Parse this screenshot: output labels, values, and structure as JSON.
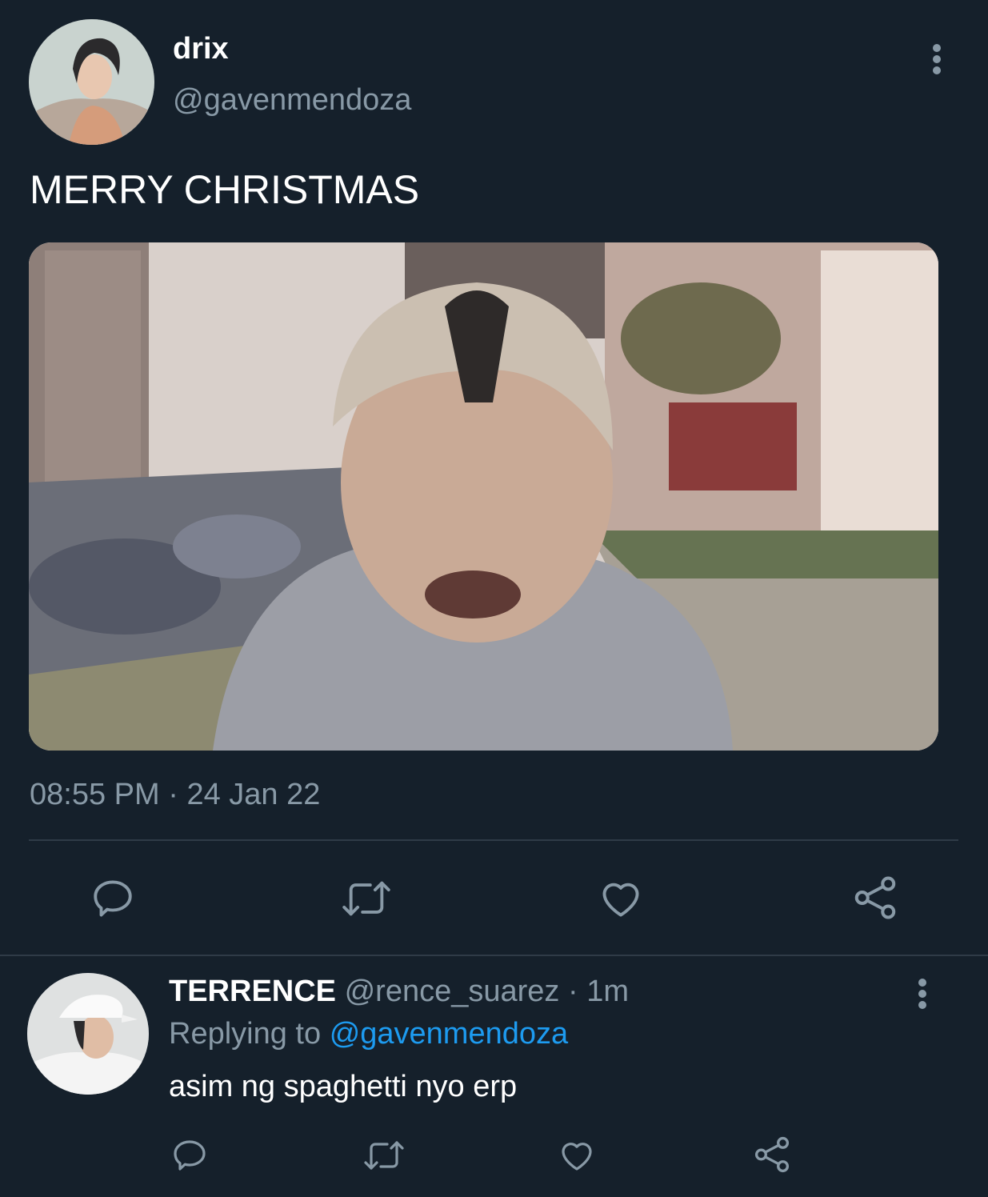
{
  "tweet": {
    "display_name": "drix",
    "handle": "@gavenmendoza",
    "text": "MERRY CHRISTMAS",
    "time": "08:55 PM",
    "separator": "·",
    "date": "24 Jan 22",
    "more_icon": "more-vertical-icon"
  },
  "actions": [
    {
      "name": "reply",
      "icon": "comment-icon"
    },
    {
      "name": "retweet",
      "icon": "retweet-icon"
    },
    {
      "name": "like",
      "icon": "heart-icon"
    },
    {
      "name": "share",
      "icon": "share-icon"
    }
  ],
  "reply": {
    "display_name": "TERRENCE",
    "handle": "@rence_suarez",
    "age": "· 1m",
    "replying_label": "Replying to",
    "replying_handle": "@gavenmendoza",
    "text": "asim ng spaghetti nyo erp"
  },
  "colors": {
    "background": "#15202b",
    "muted_text": "#8899a6",
    "link": "#1d9bf0",
    "divider": "#2f3b47"
  }
}
